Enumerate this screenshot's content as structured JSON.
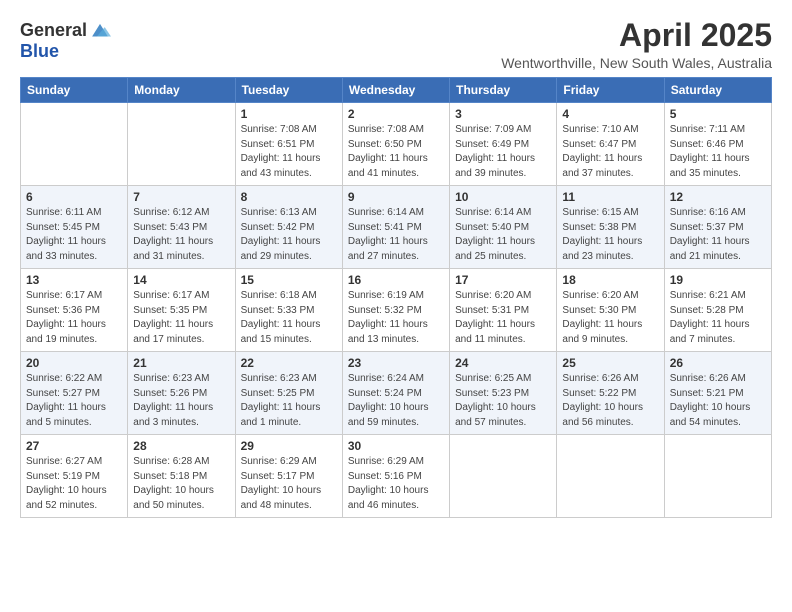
{
  "header": {
    "logo_general": "General",
    "logo_blue": "Blue",
    "month": "April 2025",
    "location": "Wentworthville, New South Wales, Australia"
  },
  "days_of_week": [
    "Sunday",
    "Monday",
    "Tuesday",
    "Wednesday",
    "Thursday",
    "Friday",
    "Saturday"
  ],
  "weeks": [
    [
      {
        "day": "",
        "info": ""
      },
      {
        "day": "",
        "info": ""
      },
      {
        "day": "1",
        "info": "Sunrise: 7:08 AM\nSunset: 6:51 PM\nDaylight: 11 hours and 43 minutes."
      },
      {
        "day": "2",
        "info": "Sunrise: 7:08 AM\nSunset: 6:50 PM\nDaylight: 11 hours and 41 minutes."
      },
      {
        "day": "3",
        "info": "Sunrise: 7:09 AM\nSunset: 6:49 PM\nDaylight: 11 hours and 39 minutes."
      },
      {
        "day": "4",
        "info": "Sunrise: 7:10 AM\nSunset: 6:47 PM\nDaylight: 11 hours and 37 minutes."
      },
      {
        "day": "5",
        "info": "Sunrise: 7:11 AM\nSunset: 6:46 PM\nDaylight: 11 hours and 35 minutes."
      }
    ],
    [
      {
        "day": "6",
        "info": "Sunrise: 6:11 AM\nSunset: 5:45 PM\nDaylight: 11 hours and 33 minutes."
      },
      {
        "day": "7",
        "info": "Sunrise: 6:12 AM\nSunset: 5:43 PM\nDaylight: 11 hours and 31 minutes."
      },
      {
        "day": "8",
        "info": "Sunrise: 6:13 AM\nSunset: 5:42 PM\nDaylight: 11 hours and 29 minutes."
      },
      {
        "day": "9",
        "info": "Sunrise: 6:14 AM\nSunset: 5:41 PM\nDaylight: 11 hours and 27 minutes."
      },
      {
        "day": "10",
        "info": "Sunrise: 6:14 AM\nSunset: 5:40 PM\nDaylight: 11 hours and 25 minutes."
      },
      {
        "day": "11",
        "info": "Sunrise: 6:15 AM\nSunset: 5:38 PM\nDaylight: 11 hours and 23 minutes."
      },
      {
        "day": "12",
        "info": "Sunrise: 6:16 AM\nSunset: 5:37 PM\nDaylight: 11 hours and 21 minutes."
      }
    ],
    [
      {
        "day": "13",
        "info": "Sunrise: 6:17 AM\nSunset: 5:36 PM\nDaylight: 11 hours and 19 minutes."
      },
      {
        "day": "14",
        "info": "Sunrise: 6:17 AM\nSunset: 5:35 PM\nDaylight: 11 hours and 17 minutes."
      },
      {
        "day": "15",
        "info": "Sunrise: 6:18 AM\nSunset: 5:33 PM\nDaylight: 11 hours and 15 minutes."
      },
      {
        "day": "16",
        "info": "Sunrise: 6:19 AM\nSunset: 5:32 PM\nDaylight: 11 hours and 13 minutes."
      },
      {
        "day": "17",
        "info": "Sunrise: 6:20 AM\nSunset: 5:31 PM\nDaylight: 11 hours and 11 minutes."
      },
      {
        "day": "18",
        "info": "Sunrise: 6:20 AM\nSunset: 5:30 PM\nDaylight: 11 hours and 9 minutes."
      },
      {
        "day": "19",
        "info": "Sunrise: 6:21 AM\nSunset: 5:28 PM\nDaylight: 11 hours and 7 minutes."
      }
    ],
    [
      {
        "day": "20",
        "info": "Sunrise: 6:22 AM\nSunset: 5:27 PM\nDaylight: 11 hours and 5 minutes."
      },
      {
        "day": "21",
        "info": "Sunrise: 6:23 AM\nSunset: 5:26 PM\nDaylight: 11 hours and 3 minutes."
      },
      {
        "day": "22",
        "info": "Sunrise: 6:23 AM\nSunset: 5:25 PM\nDaylight: 11 hours and 1 minute."
      },
      {
        "day": "23",
        "info": "Sunrise: 6:24 AM\nSunset: 5:24 PM\nDaylight: 10 hours and 59 minutes."
      },
      {
        "day": "24",
        "info": "Sunrise: 6:25 AM\nSunset: 5:23 PM\nDaylight: 10 hours and 57 minutes."
      },
      {
        "day": "25",
        "info": "Sunrise: 6:26 AM\nSunset: 5:22 PM\nDaylight: 10 hours and 56 minutes."
      },
      {
        "day": "26",
        "info": "Sunrise: 6:26 AM\nSunset: 5:21 PM\nDaylight: 10 hours and 54 minutes."
      }
    ],
    [
      {
        "day": "27",
        "info": "Sunrise: 6:27 AM\nSunset: 5:19 PM\nDaylight: 10 hours and 52 minutes."
      },
      {
        "day": "28",
        "info": "Sunrise: 6:28 AM\nSunset: 5:18 PM\nDaylight: 10 hours and 50 minutes."
      },
      {
        "day": "29",
        "info": "Sunrise: 6:29 AM\nSunset: 5:17 PM\nDaylight: 10 hours and 48 minutes."
      },
      {
        "day": "30",
        "info": "Sunrise: 6:29 AM\nSunset: 5:16 PM\nDaylight: 10 hours and 46 minutes."
      },
      {
        "day": "",
        "info": ""
      },
      {
        "day": "",
        "info": ""
      },
      {
        "day": "",
        "info": ""
      }
    ]
  ]
}
